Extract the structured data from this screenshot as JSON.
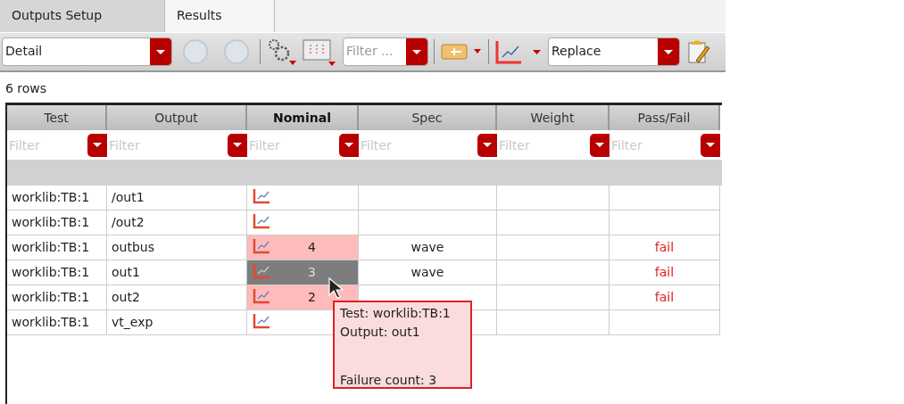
{
  "tabs": [
    {
      "label": "Outputs Setup",
      "selected": false
    },
    {
      "label": "Results",
      "selected": true
    }
  ],
  "toolbar": {
    "view": "Detail",
    "filter_placeholder": "Filter ...",
    "plot_mode": "Replace"
  },
  "row_count": "6 rows",
  "table": {
    "columns": [
      {
        "label": "Test",
        "bold": false,
        "filter_placeholder": "Filter"
      },
      {
        "label": "Output",
        "bold": false,
        "filter_placeholder": "Filter"
      },
      {
        "label": "Nominal",
        "bold": true,
        "filter_placeholder": "Filter"
      },
      {
        "label": "Spec",
        "bold": false,
        "filter_placeholder": "Filter"
      },
      {
        "label": "Weight",
        "bold": false,
        "filter_placeholder": "Filter"
      },
      {
        "label": "Pass/Fail",
        "bold": false,
        "filter_placeholder": "Filter"
      }
    ],
    "rows": [
      {
        "test": "worklib:TB:1",
        "output": "/out1",
        "nominal": "",
        "failed": false,
        "selected": false,
        "spec": "",
        "weight": "",
        "pass_fail": ""
      },
      {
        "test": "worklib:TB:1",
        "output": "/out2",
        "nominal": "",
        "failed": false,
        "selected": false,
        "spec": "",
        "weight": "",
        "pass_fail": ""
      },
      {
        "test": "worklib:TB:1",
        "output": "outbus",
        "nominal": "4",
        "failed": true,
        "selected": false,
        "spec": "wave",
        "weight": "",
        "pass_fail": "fail"
      },
      {
        "test": "worklib:TB:1",
        "output": "out1",
        "nominal": "3",
        "selected": true,
        "spec": "wave",
        "weight": "",
        "pass_fail": "fail"
      },
      {
        "test": "worklib:TB:1",
        "output": "out2",
        "nominal": "2",
        "failed": true,
        "selected": false,
        "weight": "",
        "pass_fail": "fail"
      },
      {
        "test": "worklib:TB:1",
        "output": "vt_exp",
        "nominal": "",
        "failed": false,
        "selected": false,
        "spec": "",
        "weight": "",
        "pass_fail": ""
      }
    ]
  },
  "tooltip": {
    "lines": [
      "Test:  worklib:TB:1",
      "Output:  out1",
      "Failure count: 3"
    ]
  }
}
